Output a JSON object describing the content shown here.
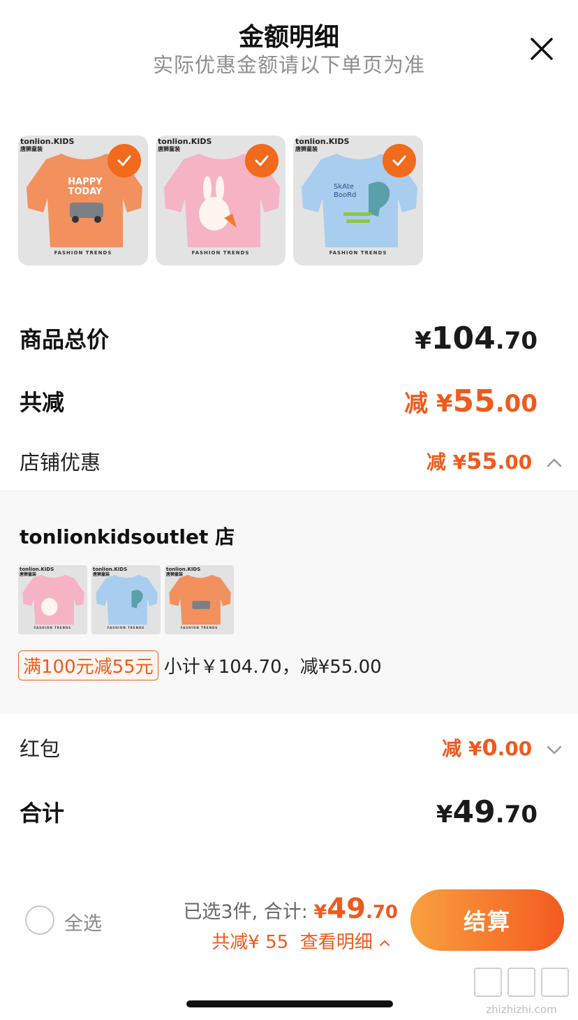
{
  "header": {
    "title": "金额明细",
    "subtitle": "实际优惠金额请以下单页为准"
  },
  "selected_items": [
    {
      "brand": "tonlion.KIDS",
      "brand_cn": "唐狮童装",
      "print_text": "HAPPY TODAY",
      "footer": "FASHION TRENDS",
      "shirt_color": "#f2905e",
      "checked": true
    },
    {
      "brand": "tonlion.KIDS",
      "brand_cn": "唐狮童装",
      "print_text": "",
      "footer": "FASHION TRENDS",
      "shirt_color": "#f5b3c4",
      "checked": true
    },
    {
      "brand": "tonlion.KIDS",
      "brand_cn": "唐狮童装",
      "print_text": "SkAte BooRd",
      "footer": "FASHION TRENDS",
      "shirt_color": "#a9cdee",
      "checked": true
    }
  ],
  "goods_total": {
    "label": "商品总价",
    "yen": "¥",
    "int": "104",
    "dec": ".70"
  },
  "total_discount": {
    "label": "共减",
    "prefix": "减 ¥",
    "int": "55",
    "dec": ".00"
  },
  "store_discount": {
    "label": "店铺优惠",
    "prefix": "减 ¥",
    "int": "55",
    "dec": ".00"
  },
  "store": {
    "name": "tonlionkidsoutlet 店",
    "items": [
      {
        "shirt_color": "#f5b3c4",
        "brand": "tonlion.KIDS",
        "brand_cn": "唐狮童装",
        "footer": "FASHION TRENDS"
      },
      {
        "shirt_color": "#a9cdee",
        "brand": "tonlion.KIDS",
        "brand_cn": "唐狮童装",
        "footer": "FASHION TRENDS"
      },
      {
        "shirt_color": "#f2905e",
        "brand": "tonlion.KIDS",
        "brand_cn": "唐狮童装",
        "footer": "FASHION TRENDS"
      }
    ],
    "promo_tag": "满100元减55元",
    "promo_detail": "小计￥104.70，减¥55.00"
  },
  "red_packet": {
    "label": "红包",
    "prefix": "减 ¥",
    "int": "0",
    "dec": ".00"
  },
  "grand_total": {
    "label": "合计",
    "yen": "¥",
    "int": "49",
    "dec": ".70"
  },
  "bottom_bar": {
    "select_all": "全选",
    "selected_prefix": "已选3件, 合计:",
    "amount_yen": "¥",
    "amount_int": "49",
    "amount_dec": ".70",
    "discount_note": "共减¥ 55",
    "view_detail": "查看明细",
    "checkout": "结算"
  },
  "watermark": {
    "text": "zhizhizhi.com"
  },
  "colors": {
    "accent": "#f05a1d",
    "checkout_start": "#f9a03f",
    "checkout_end": "#f45b1f"
  }
}
